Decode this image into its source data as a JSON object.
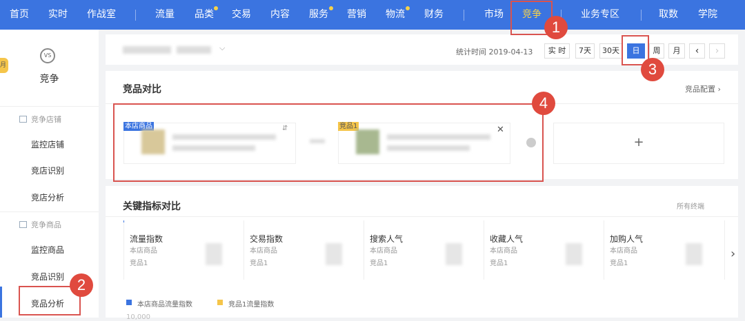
{
  "topnav": {
    "items": [
      "首页",
      "实时",
      "作战室",
      "流量",
      "品类",
      "交易",
      "内容",
      "服务",
      "营销",
      "物流",
      "财务",
      "市场",
      "竞争",
      "业务专区",
      "取数",
      "学院"
    ]
  },
  "sidebar": {
    "tab_label": "月",
    "logo_text": "VS",
    "title": "竞争",
    "group1": "竞争店铺",
    "links1": [
      "监控店铺",
      "竞店识别",
      "竞店分析"
    ],
    "group2": "竞争商品",
    "links2": [
      "监控商品",
      "竞品识别",
      "竞品分析"
    ]
  },
  "toolbar": {
    "stat_time": "统计时间 2019-04-13",
    "buttons": [
      "实 时",
      "7天",
      "30天",
      "日",
      "周",
      "月"
    ],
    "prev": "‹",
    "next": "›",
    "dropdown_chevron": "⌵"
  },
  "compare": {
    "title": "竞品对比",
    "config_link": "竞品配置 ›",
    "own_tag": "本店商品",
    "rival_tag": "竞品1",
    "add": "+",
    "close": "✕",
    "swap": "⇵"
  },
  "metrics": {
    "title": "关键指标对比",
    "filter": "所有终端",
    "row1": "本店商品",
    "row2": "竞品1",
    "cards": [
      "流量指数",
      "交易指数",
      "搜索人气",
      "收藏人气",
      "加购人气"
    ],
    "next": "›"
  },
  "legend": {
    "own": "本店商品流量指数",
    "rival": "竞品1流量指数",
    "axis_top": "10,000"
  },
  "annotations": [
    "1",
    "2",
    "3",
    "4"
  ],
  "colors": {
    "primary": "#3b74e0",
    "accent": "#f5c54a",
    "annotation": "#e04a3e"
  }
}
